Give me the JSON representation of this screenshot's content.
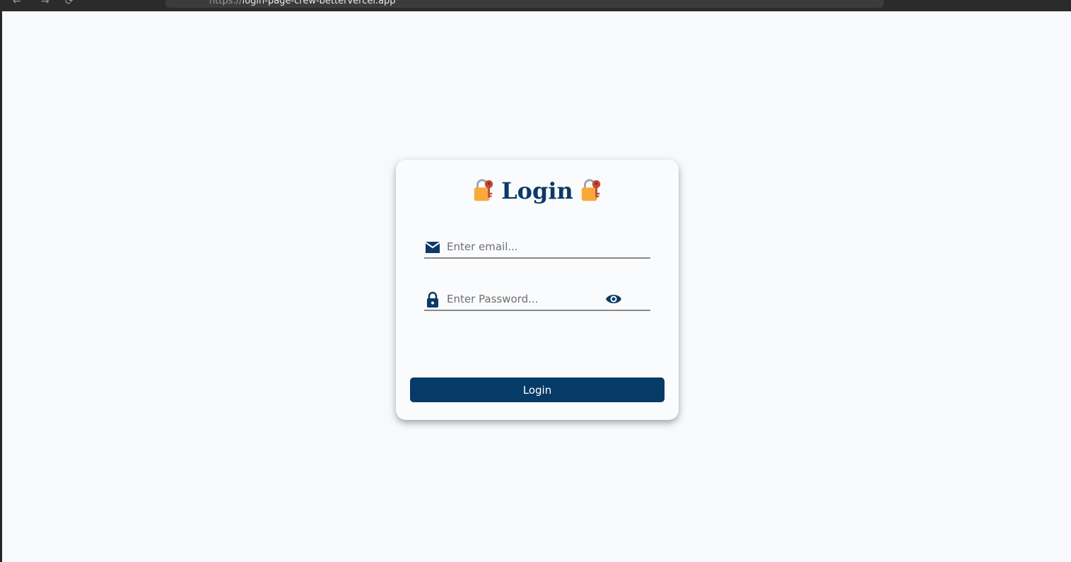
{
  "browser": {
    "url_scheme": "https://",
    "url_rest": "login-page-crew-bettervercel.app"
  },
  "card": {
    "title": "Login",
    "title_icon": "locked-with-key-icon",
    "email": {
      "placeholder": "Enter email...",
      "value": "",
      "icon": "mail-icon"
    },
    "password": {
      "placeholder": "Enter Password...",
      "value": "",
      "icon": "lock-icon",
      "toggle_icon": "eye-icon"
    },
    "login_button": "Login"
  },
  "colors": {
    "page_background": "#f7f9fd",
    "accent": "#0b3a66",
    "button": "#063a67",
    "button_text": "#ffffff"
  }
}
